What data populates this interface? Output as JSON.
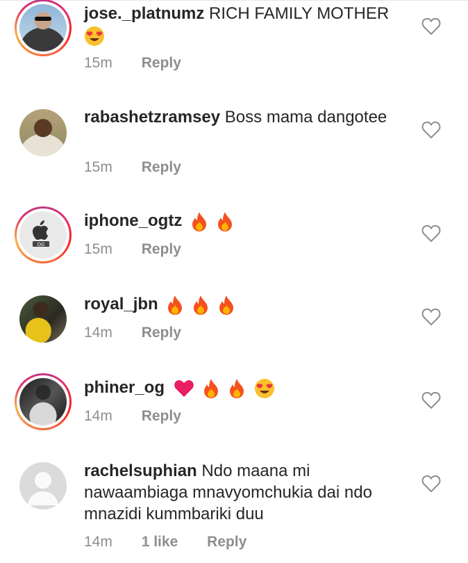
{
  "comments": [
    {
      "username": "jose._platnumz",
      "text": "RICH FAMILY MOTHER",
      "emojis": [
        "heart-eyes"
      ],
      "time": "15m",
      "reply": "Reply",
      "has_story_ring": true
    },
    {
      "username": "rabashetzramsey",
      "text": "Boss mama dangotee",
      "emojis": [],
      "time": "15m",
      "reply": "Reply",
      "has_story_ring": false
    },
    {
      "username": "iphone_ogtz",
      "text": "",
      "emojis": [
        "fire",
        "fire"
      ],
      "time": "15m",
      "reply": "Reply",
      "has_story_ring": true,
      "avatar_text": "OG"
    },
    {
      "username": "royal_jbn",
      "text": "",
      "emojis": [
        "fire",
        "fire",
        "fire"
      ],
      "time": "14m",
      "reply": "Reply",
      "has_story_ring": false
    },
    {
      "username": "phiner_og",
      "text": "",
      "emojis": [
        "pink-heart",
        "fire",
        "fire",
        "heart-eyes"
      ],
      "time": "14m",
      "reply": "Reply",
      "has_story_ring": true
    },
    {
      "username": "rachelsuphian",
      "text": "Ndo maana mi nawaambiaga mnavyomchukia dai ndo mnazidi kummbariki duu",
      "emojis": [],
      "time": "14m",
      "likes": "1 like",
      "reply": "Reply",
      "has_story_ring": false
    }
  ],
  "colors": {
    "text": "#262626",
    "meta": "#8e8e8e",
    "fire": "#f4511e",
    "pink_heart": "#e91e63",
    "emoji_face": "#fbc02d"
  }
}
